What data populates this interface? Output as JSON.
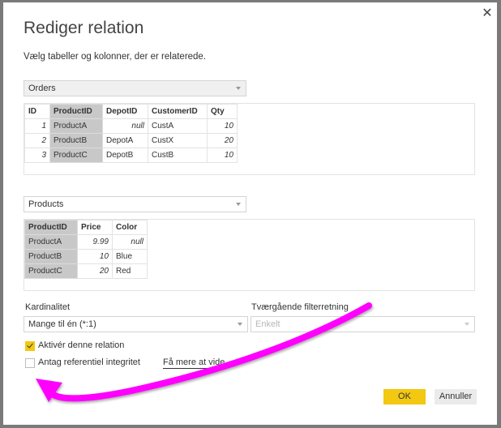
{
  "dialog": {
    "title": "Rediger relation",
    "subtitle": "Vælg tabeller og kolonner, der er relaterede.",
    "close_icon": "close-icon"
  },
  "table1": {
    "selected": "Orders",
    "columns": [
      "ID",
      "ProductID",
      "DepotID",
      "CustomerID",
      "Qty"
    ],
    "rows": [
      [
        "1",
        "ProductA",
        "null",
        "CustA",
        "10"
      ],
      [
        "2",
        "ProductB",
        "DepotA",
        "CustX",
        "20"
      ],
      [
        "3",
        "ProductC",
        "DepotB",
        "CustB",
        "10"
      ]
    ],
    "selected_column": "ProductID"
  },
  "table2": {
    "selected": "Products",
    "columns": [
      "ProductID",
      "Price",
      "Color"
    ],
    "rows": [
      [
        "ProductA",
        "9.99",
        "null"
      ],
      [
        "ProductB",
        "10",
        "Blue"
      ],
      [
        "ProductC",
        "20",
        "Red"
      ]
    ],
    "selected_column": "ProductID"
  },
  "cardinality": {
    "label": "Kardinalitet",
    "value": "Mange til én (*:1)"
  },
  "filter_direction": {
    "label": "Tværgående filterretning",
    "value": "Enkelt",
    "disabled": true
  },
  "options": {
    "activate": {
      "label": "Aktivér denne relation",
      "checked": true
    },
    "referential_integrity": {
      "label": "Antag referentiel integritet",
      "checked": false
    },
    "learn_more": "Få mere at vide"
  },
  "buttons": {
    "ok": "OK",
    "cancel": "Annuller"
  },
  "colors": {
    "accent": "#f2c811",
    "annotation_arrow": "#ff00ff",
    "key_column": "#c8c8c8"
  }
}
